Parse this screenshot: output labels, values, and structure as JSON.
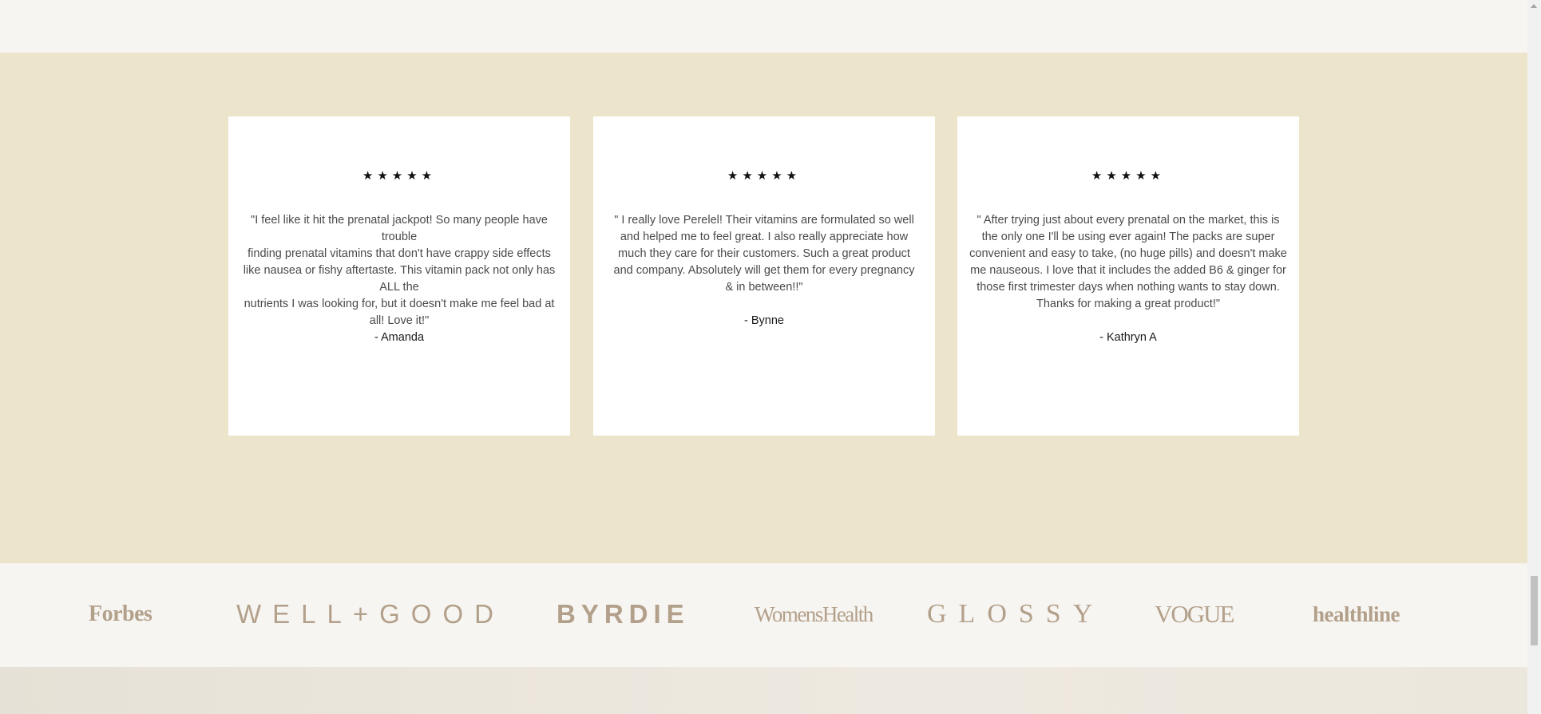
{
  "reviews": [
    {
      "rating_stars": "★★★★★",
      "text": "\"I feel like it hit the prenatal jackpot! So many people have trouble\nfinding prenatal vitamins that don't have crappy side effects like nausea or fishy aftertaste. This vitamin pack not only has ALL the\nnutrients I was looking for, but it doesn't make me feel bad at all! Love it!\"",
      "author": "- Amanda"
    },
    {
      "rating_stars": "★★★★★",
      "text": "\" I really love Perelel! Their vitamins are formulated so well and helped me to feel great. I also really appreciate how much they care for their customers. Such a great product and company. Absolutely will get them for every pregnancy & in between!!\"",
      "author": "- Bynne"
    },
    {
      "rating_stars": "★★★★★",
      "text": "\" After trying just about every prenatal on the market, this is the only one I'll be using ever again! The packs are super convenient and easy to take, (no huge pills) and doesn't make me nauseous. I love that it includes the added B6 & ginger for those first trimester days when nothing wants to stay down. Thanks for making a great product!\"",
      "author": "- Kathryn A"
    }
  ],
  "press_logos": [
    "Forbes",
    "WELL+GOOD",
    "BYRDIE",
    "WomensHealth",
    "GLOSSY",
    "VOGUE",
    "healthline"
  ],
  "colors": {
    "reviews_background": "#ede4cc",
    "card_background": "#ffffff",
    "logo_color": "#b3a08a",
    "page_background": "#f7f5f2"
  }
}
